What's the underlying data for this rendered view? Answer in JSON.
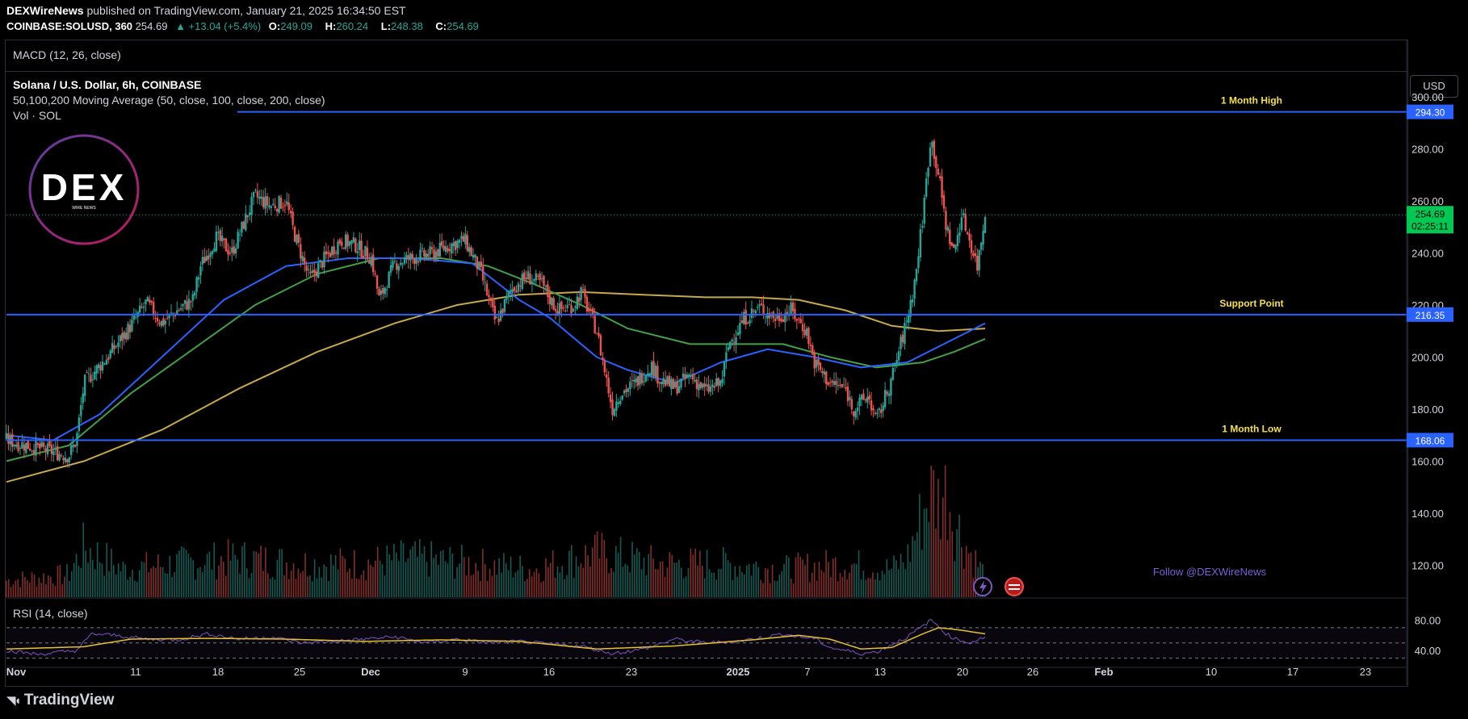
{
  "header": {
    "publisher": "DEXWireNews",
    "published_text": "published on TradingView.com, January 21, 2025 16:34:50 EST",
    "symbol": "COINBASE:SOLUSD, 360",
    "price": "254.69",
    "change": "▲ +13.04 (+5.4%)",
    "ohlc": {
      "o_label": "O:",
      "o": "249.09",
      "h_label": "H:",
      "h": "260.24",
      "l_label": "L:",
      "l": "248.38",
      "c_label": "C:",
      "c": "254.69"
    }
  },
  "panes": {
    "macd_label": "MACD (12, 26, close)",
    "chart_title": "Solana / U.S. Dollar, 6h, COINBASE",
    "ma_label": "50,100,200 Moving Average (50, close, 100, close, 200, close)",
    "vol_label": "Vol · SOL",
    "rsi_label": "RSI (14, close)"
  },
  "currency_button": "USD",
  "logo": {
    "text": "DEX",
    "subtext": "WIRE NEWS"
  },
  "watermark": "Follow @DEXWireNews",
  "footer_brand": "TradingView",
  "colors": {
    "up": "#26a69a",
    "down": "#ef5350",
    "level": "#2962ff",
    "ma50": "#2962ff",
    "ma100": "#43a047",
    "ma200": "#c8a84a",
    "rsi": "#7e57c2",
    "rsi_ma": "#e6c229",
    "label": "#f5e14a"
  },
  "chart_data": {
    "type": "candlestick",
    "ylim": [
      108,
      310
    ],
    "y_ticks": [
      "120.00",
      "140.00",
      "160.00",
      "180.00",
      "200.00",
      "220.00",
      "240.00",
      "260.00",
      "280.00",
      "300.00"
    ],
    "x_ticks": [
      "Nov",
      "11",
      "18",
      "25",
      "Dec",
      "9",
      "16",
      "23",
      "2025",
      "7",
      "13",
      "20",
      "26",
      "Feb",
      "10",
      "17",
      "23"
    ],
    "price_tag": {
      "value": "254.69",
      "countdown": "02:25:11"
    },
    "levels": [
      {
        "name": "1 Month High",
        "value": 294.3,
        "tag": "294.30"
      },
      {
        "name": "Support Point",
        "value": 216.35,
        "tag": "216.35"
      },
      {
        "name": "1 Month Low",
        "value": 168.06,
        "tag": "168.06"
      }
    ],
    "close_path": [
      [
        0,
        168
      ],
      [
        4,
        165
      ],
      [
        8,
        162
      ],
      [
        9,
        168
      ],
      [
        10,
        190
      ],
      [
        13,
        200
      ],
      [
        16,
        212
      ],
      [
        18,
        221
      ],
      [
        20,
        213
      ],
      [
        22,
        218
      ],
      [
        24,
        222
      ],
      [
        25,
        235
      ],
      [
        27,
        246
      ],
      [
        29,
        240
      ],
      [
        32,
        262
      ],
      [
        34,
        258
      ],
      [
        36,
        260
      ],
      [
        37,
        248
      ],
      [
        39,
        230
      ],
      [
        41,
        238
      ],
      [
        43,
        245
      ],
      [
        45,
        243
      ],
      [
        47,
        238
      ],
      [
        48,
        222
      ],
      [
        50,
        236
      ],
      [
        52,
        238
      ],
      [
        55,
        240
      ],
      [
        57,
        243
      ],
      [
        59,
        245
      ],
      [
        61,
        233
      ],
      [
        63,
        213
      ],
      [
        65,
        226
      ],
      [
        67,
        231
      ],
      [
        69,
        228
      ],
      [
        70,
        222
      ],
      [
        71,
        218
      ],
      [
        73,
        220
      ],
      [
        74,
        225
      ],
      [
        76,
        210
      ],
      [
        78,
        180
      ],
      [
        79,
        186
      ],
      [
        81,
        190
      ],
      [
        83,
        197
      ],
      [
        84,
        192
      ],
      [
        86,
        188
      ],
      [
        88,
        193
      ],
      [
        90,
        187
      ],
      [
        92,
        190
      ],
      [
        93,
        205
      ],
      [
        95,
        215
      ],
      [
        97,
        219
      ],
      [
        99,
        215
      ],
      [
        101,
        218
      ],
      [
        103,
        210
      ],
      [
        104,
        198
      ],
      [
        106,
        190
      ],
      [
        108,
        188
      ],
      [
        109,
        180
      ],
      [
        111,
        185
      ],
      [
        112,
        175
      ],
      [
        114,
        192
      ],
      [
        116,
        215
      ],
      [
        117,
        230
      ],
      [
        118,
        255
      ],
      [
        119,
        285
      ],
      [
        120,
        270
      ],
      [
        121,
        250
      ],
      [
        122,
        240
      ],
      [
        123,
        255
      ],
      [
        124,
        245
      ],
      [
        125,
        235
      ],
      [
        126,
        255
      ]
    ],
    "ma50_path": [
      [
        0,
        170
      ],
      [
        6,
        168
      ],
      [
        12,
        178
      ],
      [
        20,
        200
      ],
      [
        28,
        222
      ],
      [
        36,
        235
      ],
      [
        44,
        238
      ],
      [
        52,
        238
      ],
      [
        60,
        236
      ],
      [
        66,
        222
      ],
      [
        70,
        215
      ],
      [
        76,
        200
      ],
      [
        80,
        195
      ],
      [
        86,
        190
      ],
      [
        92,
        198
      ],
      [
        98,
        203
      ],
      [
        104,
        200
      ],
      [
        110,
        196
      ],
      [
        116,
        198
      ],
      [
        120,
        204
      ],
      [
        126,
        213
      ]
    ],
    "ma100_path": [
      [
        0,
        160
      ],
      [
        8,
        166
      ],
      [
        16,
        186
      ],
      [
        24,
        203
      ],
      [
        32,
        220
      ],
      [
        40,
        232
      ],
      [
        48,
        238
      ],
      [
        56,
        238
      ],
      [
        62,
        235
      ],
      [
        68,
        228
      ],
      [
        74,
        220
      ],
      [
        80,
        211
      ],
      [
        88,
        205
      ],
      [
        94,
        205
      ],
      [
        100,
        205
      ],
      [
        106,
        200
      ],
      [
        112,
        196
      ],
      [
        118,
        198
      ],
      [
        122,
        202
      ],
      [
        126,
        207
      ]
    ],
    "ma200_path": [
      [
        0,
        152
      ],
      [
        10,
        160
      ],
      [
        20,
        172
      ],
      [
        30,
        188
      ],
      [
        40,
        202
      ],
      [
        50,
        213
      ],
      [
        58,
        220
      ],
      [
        66,
        224
      ],
      [
        74,
        225
      ],
      [
        82,
        224
      ],
      [
        90,
        223
      ],
      [
        96,
        223
      ],
      [
        102,
        222
      ],
      [
        108,
        218
      ],
      [
        114,
        212
      ],
      [
        120,
        210
      ],
      [
        126,
        211
      ]
    ],
    "volume_path": [
      [
        0,
        0.15
      ],
      [
        8,
        0.2
      ],
      [
        10,
        0.45
      ],
      [
        15,
        0.25
      ],
      [
        22,
        0.3
      ],
      [
        30,
        0.35
      ],
      [
        38,
        0.3
      ],
      [
        46,
        0.3
      ],
      [
        52,
        0.35
      ],
      [
        60,
        0.3
      ],
      [
        68,
        0.25
      ],
      [
        76,
        0.4
      ],
      [
        84,
        0.3
      ],
      [
        92,
        0.3
      ],
      [
        100,
        0.25
      ],
      [
        108,
        0.3
      ],
      [
        114,
        0.25
      ],
      [
        116,
        0.35
      ],
      [
        118,
        0.75
      ],
      [
        119,
        1.0
      ],
      [
        120,
        0.85
      ],
      [
        121,
        1.0
      ],
      [
        122,
        0.7
      ],
      [
        123,
        0.55
      ],
      [
        124,
        0.4
      ],
      [
        125,
        0.3
      ],
      [
        126,
        0.2
      ]
    ],
    "rsi_path": [
      [
        0,
        40
      ],
      [
        4,
        35
      ],
      [
        9,
        40
      ],
      [
        11,
        62
      ],
      [
        14,
        60
      ],
      [
        18,
        55
      ],
      [
        22,
        54
      ],
      [
        26,
        62
      ],
      [
        30,
        55
      ],
      [
        34,
        58
      ],
      [
        38,
        50
      ],
      [
        42,
        52
      ],
      [
        46,
        55
      ],
      [
        50,
        58
      ],
      [
        54,
        50
      ],
      [
        58,
        55
      ],
      [
        62,
        50
      ],
      [
        66,
        52
      ],
      [
        70,
        48
      ],
      [
        74,
        46
      ],
      [
        78,
        36
      ],
      [
        82,
        42
      ],
      [
        86,
        55
      ],
      [
        90,
        50
      ],
      [
        94,
        52
      ],
      [
        98,
        58
      ],
      [
        100,
        62
      ],
      [
        102,
        58
      ],
      [
        104,
        56
      ],
      [
        106,
        44
      ],
      [
        108,
        40
      ],
      [
        110,
        36
      ],
      [
        112,
        38
      ],
      [
        114,
        48
      ],
      [
        116,
        58
      ],
      [
        118,
        72
      ],
      [
        119,
        80
      ],
      [
        120,
        72
      ],
      [
        121,
        62
      ],
      [
        122,
        56
      ],
      [
        124,
        50
      ],
      [
        126,
        58
      ]
    ],
    "rsi_ma_path": [
      [
        0,
        42
      ],
      [
        10,
        45
      ],
      [
        16,
        55
      ],
      [
        26,
        56
      ],
      [
        36,
        55
      ],
      [
        46,
        52
      ],
      [
        56,
        54
      ],
      [
        66,
        52
      ],
      [
        76,
        42
      ],
      [
        86,
        46
      ],
      [
        96,
        54
      ],
      [
        102,
        60
      ],
      [
        106,
        55
      ],
      [
        110,
        42
      ],
      [
        114,
        44
      ],
      [
        118,
        62
      ],
      [
        120,
        70
      ],
      [
        122,
        68
      ],
      [
        126,
        62
      ]
    ],
    "rsi_levels": [
      70,
      50,
      30
    ],
    "rsi_ticks": [
      "80.00",
      "40.00"
    ]
  }
}
